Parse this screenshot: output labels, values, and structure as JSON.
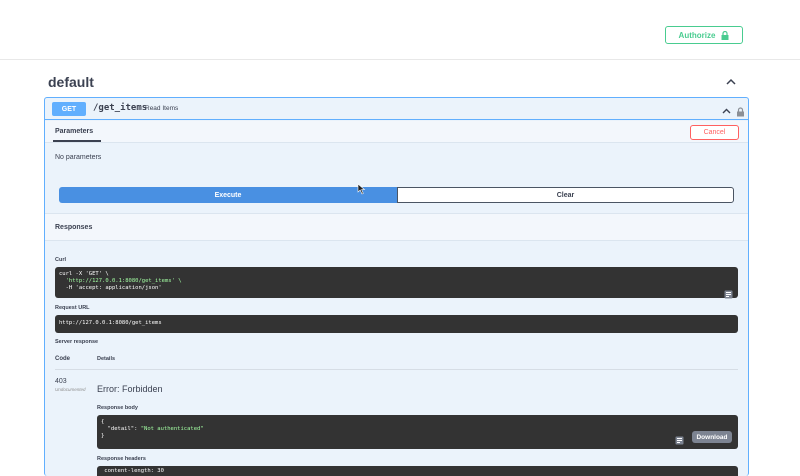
{
  "header": {
    "authorize_label": "Authorize"
  },
  "section": {
    "title": "default"
  },
  "operation": {
    "method": "GET",
    "path": "/get_items",
    "summary": "Read Items"
  },
  "parameters": {
    "tab_label": "Parameters",
    "cancel_label": "Cancel",
    "empty_text": "No parameters"
  },
  "actions": {
    "execute_label": "Execute",
    "clear_label": "Clear"
  },
  "responses": {
    "title": "Responses",
    "curl_label": "Curl",
    "curl_lines": [
      "curl -X 'GET' \\",
      "  'http://127.0.0.1:8080/get_items' \\",
      "  -H 'accept: application/json'"
    ],
    "request_url_label": "Request URL",
    "request_url": "http://127.0.0.1:8080/get_items",
    "server_response_label": "Server response",
    "code_header": "Code",
    "details_header": "Details",
    "status_code": "403",
    "undocumented_label": "Undocumented",
    "error_text": "Error: Forbidden",
    "response_body_label": "Response body",
    "response_body": {
      "open": "{",
      "key": "  \"detail\": ",
      "value": "\"Not authenticated\"",
      "close": "}"
    },
    "download_label": "Download",
    "response_headers_label": "Response headers",
    "response_headers_line": " content-length: 30 "
  }
}
